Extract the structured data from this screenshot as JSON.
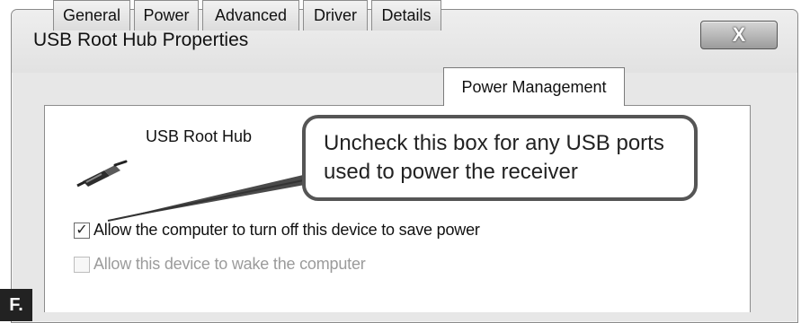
{
  "window": {
    "title": "USB Root Hub Properties",
    "close_label": "X"
  },
  "tabs": [
    {
      "label": "General"
    },
    {
      "label": "Power"
    },
    {
      "label": "Advanced"
    },
    {
      "label": "Driver"
    },
    {
      "label": "Details"
    },
    {
      "label": "Power Management",
      "active": true
    }
  ],
  "device": {
    "name": "USB Root Hub",
    "icon": "usb-plug-icon"
  },
  "callout": {
    "text": "Uncheck this box for any USB ports used to power the receiver"
  },
  "options": [
    {
      "label": "Allow the computer to turn off this device to save power",
      "checked": true,
      "enabled": true
    },
    {
      "label": "Allow this device to wake the computer",
      "checked": false,
      "enabled": false
    }
  ],
  "figure_label": "F."
}
